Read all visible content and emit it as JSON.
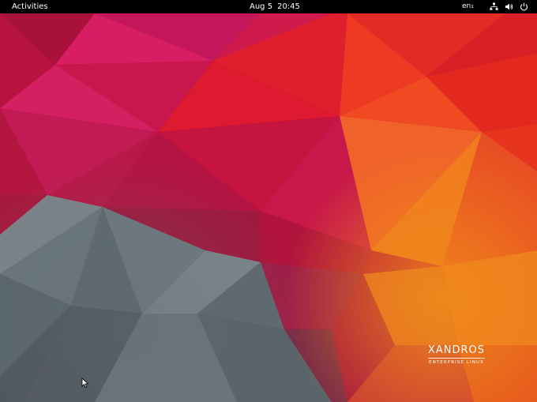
{
  "topbar": {
    "activities_label": "Activities",
    "date": "Aug 5",
    "time": "20:45",
    "input_language": "en₁",
    "icons": [
      "network-icon",
      "volume-icon",
      "power-icon"
    ]
  },
  "desktop": {
    "logo": {
      "name": "XANDROS",
      "tagline": "ENTERPRISE LINUX"
    },
    "colors": {
      "crimson": "#b8123a",
      "red": "#e01f26",
      "orange": "#f0671f",
      "slate": "#6e7a80"
    }
  }
}
